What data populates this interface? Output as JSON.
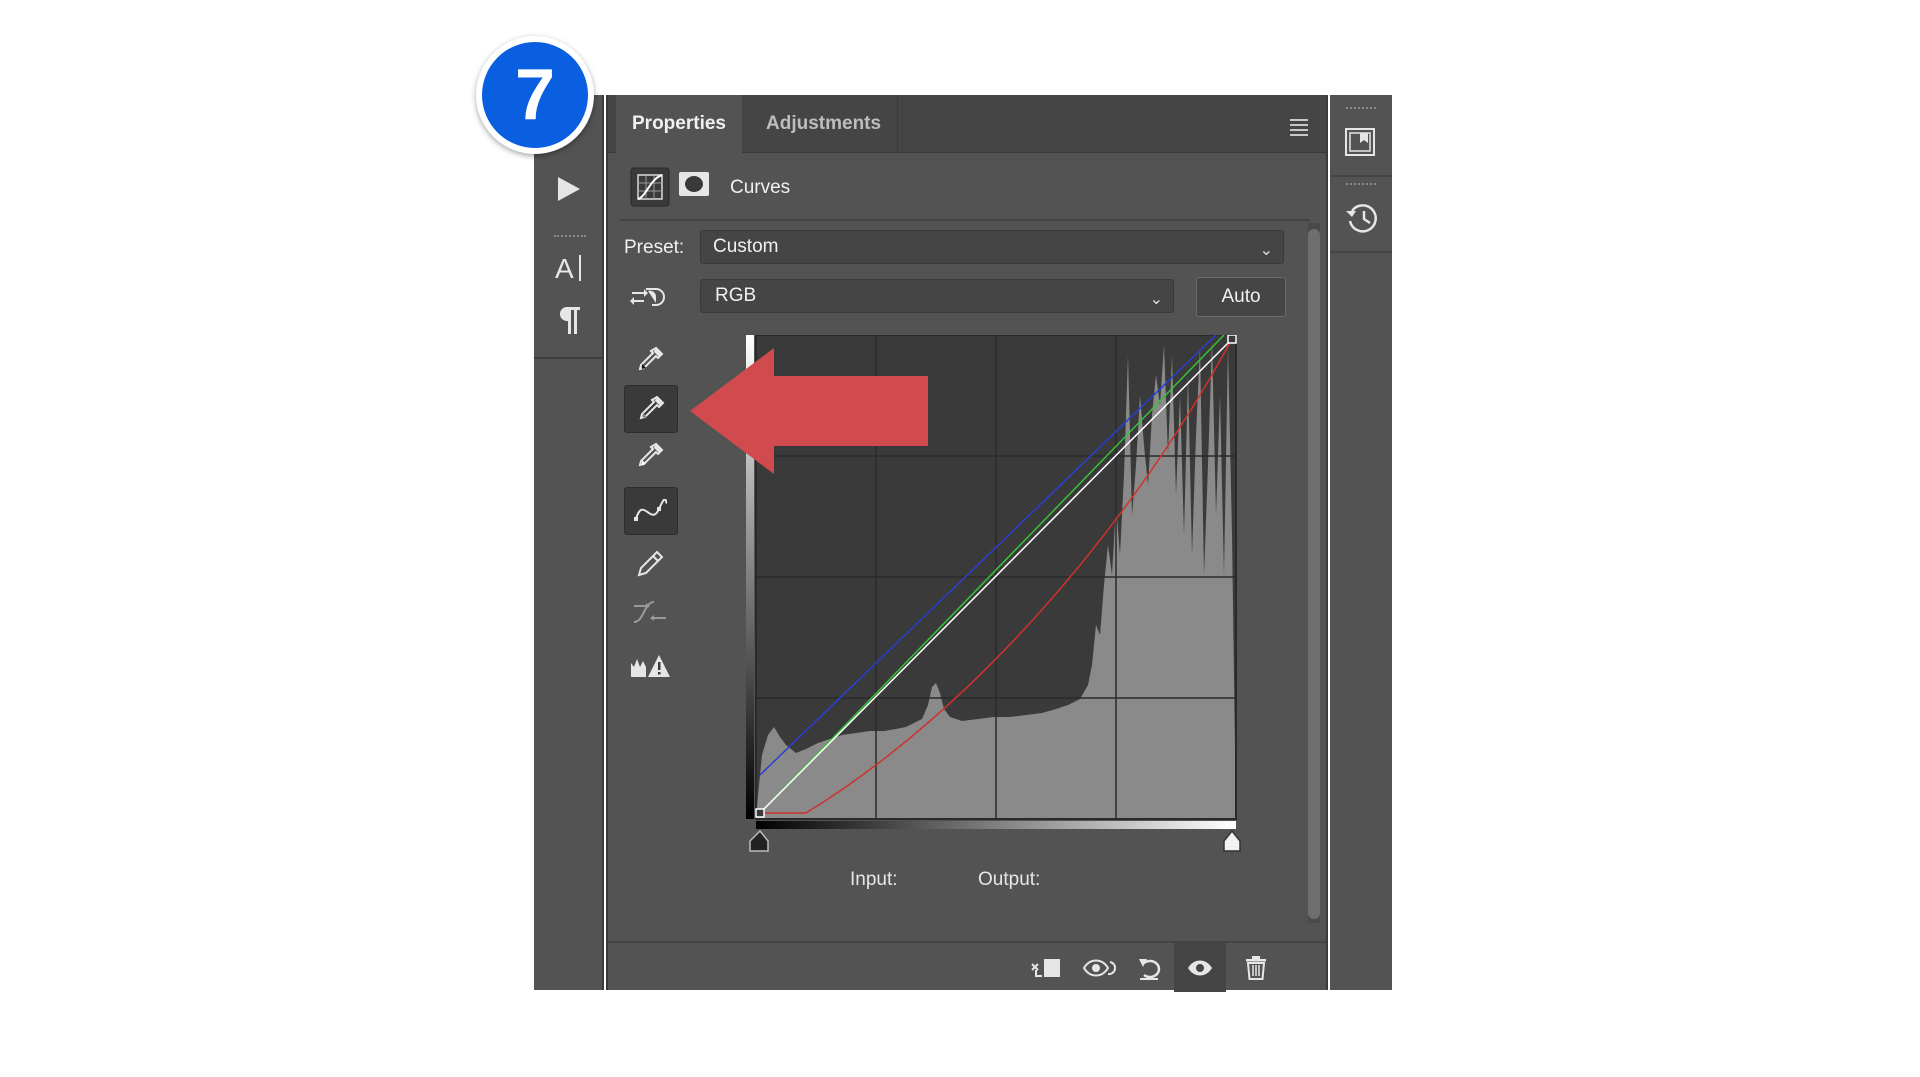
{
  "step_badge": "7",
  "panel": {
    "tabs": [
      "Properties",
      "Adjustments"
    ],
    "active_tab": "Properties",
    "adjustment_name": "Curves",
    "preset_label": "Preset:",
    "preset_value": "Custom",
    "channel_value": "RGB",
    "auto_label": "Auto",
    "input_label": "Input:",
    "output_label": "Output:"
  },
  "left_tools": [
    "play-icon",
    "character-icon",
    "paragraph-icon"
  ],
  "curves_tools": [
    "sample-black-point-eyedropper-icon",
    "sample-gray-point-eyedropper-icon",
    "sample-white-point-eyedropper-icon",
    "edit-points-curve-icon",
    "draw-pencil-icon",
    "smooth-curve-icon",
    "clipping-warning-icon"
  ],
  "footer_icons": [
    "clip-to-layer-icon",
    "view-previous-state-icon",
    "reset-icon",
    "visibility-eye-icon",
    "trash-icon"
  ],
  "right_tools": [
    "libraries-panel-icon",
    "history-panel-icon"
  ],
  "colors": {
    "badge": "#0a5fe0",
    "arrow": "#d14a4e",
    "panel_bg": "#535353",
    "curve_red": "#d0312d",
    "curve_green": "#35c235",
    "curve_blue": "#2a3fd0",
    "curve_rgb": "#ffffff"
  }
}
